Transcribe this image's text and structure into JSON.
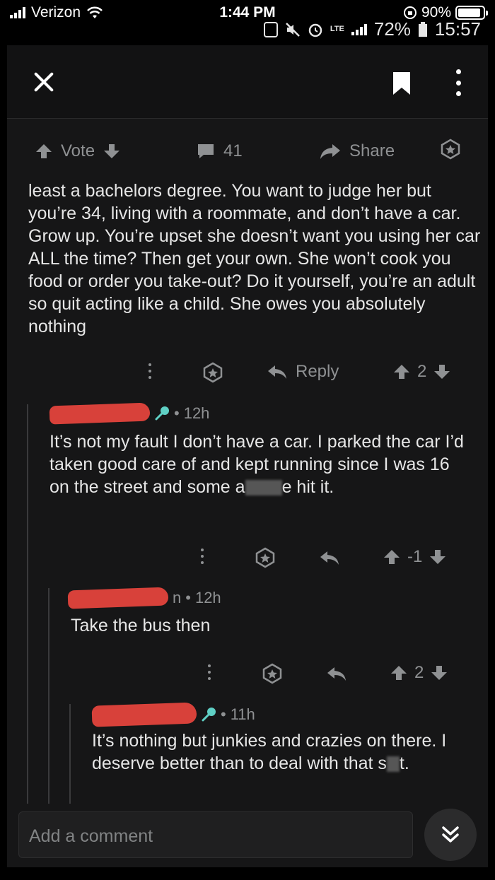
{
  "status": {
    "carrier": "Verizon",
    "time": "1:44 PM",
    "battery": "90%",
    "inner_signal": "LTE",
    "inner_battery": "72%",
    "inner_time": "15:57"
  },
  "actionbar": {
    "vote_label": "Vote",
    "comment_count": "41",
    "share_label": "Share"
  },
  "comments": [
    {
      "text": "least a bachelors degree. You want to judge her but you’re 34, living with a roommate, and don’t have a car. Grow up. You’re upset she doesn’t want you using her car ALL the time? Then get your own. She won’t cook you food or order you take-out? Do it yourself, you’re an adult so quit acting like a child. She owes you absolutely nothing",
      "reply_label": "Reply",
      "score": "2"
    },
    {
      "time": "12h",
      "text_before": "It’s not my fault I don’t have a car. I parked the car I’d taken good care of and kept running since I was 16 on the street and some a",
      "text_after": "e hit it.",
      "score": "-1"
    },
    {
      "user_suffix": "n",
      "time": "12h",
      "text": "Take the bus then",
      "score": "2"
    },
    {
      "time": "11h",
      "text_before": "It’s nothing but junkies and crazies on there. I deserve better than to deal with that s",
      "text_after": "t."
    }
  ],
  "composer": {
    "placeholder": "Add a comment"
  }
}
